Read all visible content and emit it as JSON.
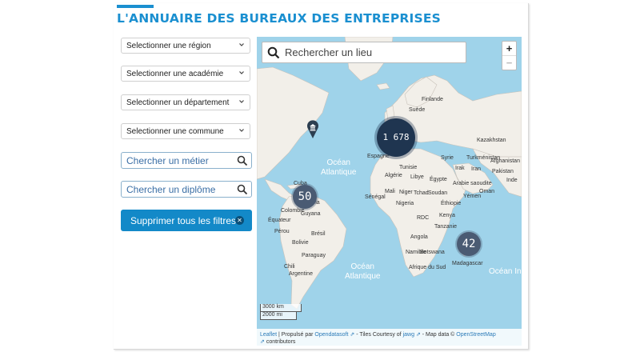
{
  "page": {
    "title": "L'ANNUAIRE DES BUREAUX DES ENTREPRISES"
  },
  "filters": {
    "region": "Selectionner une région",
    "academie": "Selectionner une académie",
    "departement": "Selectionner un département",
    "commune": "Selectionner une commune",
    "metier_placeholder": "Chercher un métier",
    "diplome_placeholder": "Chercher un diplôme",
    "clear_label": "Supprimer tous les filtres"
  },
  "map": {
    "search_placeholder": "Rechercher un lieu",
    "zoom_in": "+",
    "zoom_out": "−",
    "oceans": {
      "north": [
        "Océan",
        "Atlantique"
      ],
      "south": [
        "Océan",
        "Atlantique"
      ],
      "indian": "Océan In"
    },
    "clusters": {
      "europe": "1 678",
      "south_america": "50",
      "madagascar": "42"
    },
    "countries": {
      "finland": "Finlande",
      "sweden": "Suède",
      "kazakhstan": "Kazakhstan",
      "turkmenistan": "Turkménistan",
      "syria": "Syrie",
      "iraq": "Irak",
      "iran": "Iran",
      "afghanistan": "Afghanistan",
      "pakistan": "Pakistan",
      "india": "Inde",
      "saudi": "Arabie saoudite",
      "oman": "Oman",
      "yemen": "Yémen",
      "tunisia": "Tunisie",
      "algeria": "Algérie",
      "libya": "Libye",
      "egypt": "Égypte",
      "mali": "Mali",
      "niger": "Niger",
      "chad": "Tchad",
      "sudan": "Soudan",
      "senegal": "Sénégal",
      "nigeria": "Nigeria",
      "ethiopia": "Éthiopie",
      "congo": "RDC",
      "kenya": "Kenya",
      "tanzania": "Tanzanie",
      "angola": "Angola",
      "namibia": "Namibie",
      "botswana": "Botswana",
      "madagascar": "Madagascar",
      "south_africa": "Afrique du Sud",
      "spain": "Espagne",
      "venezuela": "Venezuela",
      "colombia": "Colombie",
      "guyana": "Guyana",
      "equateur": "Équateur",
      "peru": "Pérou",
      "brazil": "Brésil",
      "bolivia": "Bolivie",
      "paraguay": "Paraguay",
      "chile": "Chili",
      "argentina": "Argentine",
      "cuba": "Cuba"
    },
    "scale": {
      "km": "3000 km",
      "mi": "2000 mi"
    },
    "attribution": {
      "leaflet": "Leaflet",
      "propulse": "| Propulsé par",
      "ods": "Opendatasoft",
      "tiles": "- Tiles Courtesy of",
      "jawg": "jawg",
      "mapdata": "- Map data ©",
      "osm": "OpenStreetMap",
      "contributors": "contributors"
    }
  },
  "colors": {
    "accent": "#1a8fd0",
    "button": "#1389c8",
    "ocean": "#9fd3ea",
    "land": "#f2efe9"
  }
}
